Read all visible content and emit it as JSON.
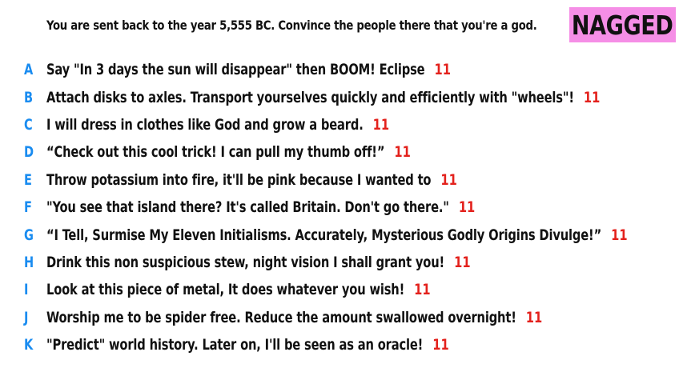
{
  "question": "You are sent back to the year 5,555 BC. Convince the people there that you're a god.",
  "badge": {
    "label": "NAGGED",
    "color": "#f58ee6"
  },
  "colors": {
    "letter": "#1a8cf0",
    "score": "#e3211c",
    "text": "#111111"
  },
  "answers": [
    {
      "letter": "A",
      "text": "Say \"In 3 days the sun will disappear\" then BOOM! Eclipse",
      "score": "11"
    },
    {
      "letter": "B",
      "text": "Attach disks to axles. Transport yourselves quickly and efficiently with \"wheels\"!",
      "score": "11"
    },
    {
      "letter": "C",
      "text": "I will dress in clothes like God and grow a beard.",
      "score": "11"
    },
    {
      "letter": "D",
      "text": "“Check out this cool trick! I can pull my thumb off!”",
      "score": "11"
    },
    {
      "letter": "E",
      "text": "Throw potassium into fire, it'll be pink because I wanted to",
      "score": "11"
    },
    {
      "letter": "F",
      "text": "\"You see that island there? It's called Britain. Don't go there.\"",
      "score": "11"
    },
    {
      "letter": "G",
      "text": "“I Tell, Surmise My Eleven Initialisms. Accurately, Mysterious Godly Origins Divulge!”",
      "score": "11"
    },
    {
      "letter": "H",
      "text": "Drink this non suspicious stew, night vision I shall grant you!",
      "score": "11"
    },
    {
      "letter": "I",
      "text": "Look at this piece of metal, It does whatever you wish!",
      "score": "11"
    },
    {
      "letter": "J",
      "text": "Worship me to be spider free. Reduce the amount swallowed overnight!",
      "score": "11"
    },
    {
      "letter": "K",
      "text": "\"Predict\" world history. Later on, I'll be seen as an oracle!",
      "score": "11"
    }
  ]
}
